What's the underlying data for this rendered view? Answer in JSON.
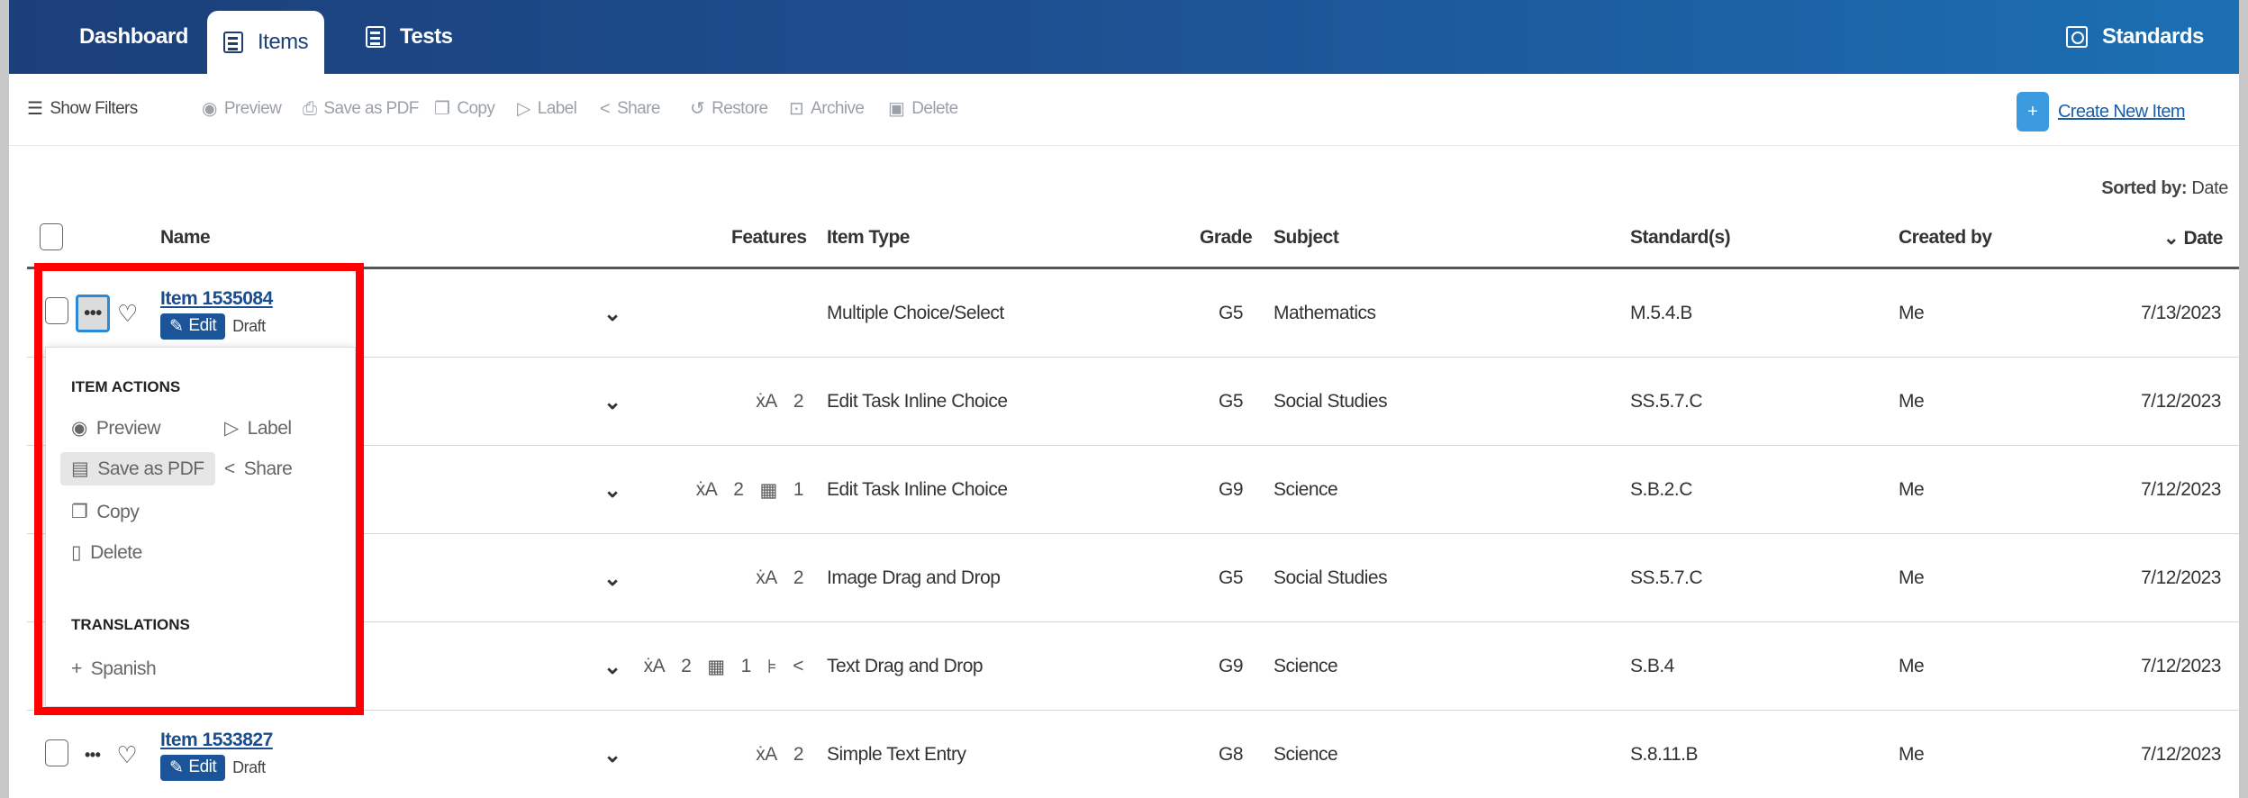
{
  "nav": {
    "dashboard": "Dashboard",
    "items": "Items",
    "tests": "Tests",
    "standards": "Standards"
  },
  "toolbar": {
    "show_filters": "Show Filters",
    "preview": "Preview",
    "save_pdf": "Save as PDF",
    "copy": "Copy",
    "label": "Label",
    "share": "Share",
    "restore": "Restore",
    "archive": "Archive",
    "delete": "Delete",
    "create_new": "Create New Item"
  },
  "sorted": {
    "label": "Sorted by:",
    "value": "Date"
  },
  "columns": {
    "name": "Name",
    "features": "Features",
    "item_type": "Item Type",
    "grade": "Grade",
    "subject": "Subject",
    "standards": "Standard(s)",
    "created_by": "Created by",
    "date": "Date"
  },
  "rows": [
    {
      "name": "Item 1535084",
      "edit": "Edit",
      "status": "Draft",
      "features": "",
      "item_type": "Multiple Choice/Select",
      "grade": "G5",
      "subject": "Mathematics",
      "standard": "M.5.4.B",
      "created_by": "Me",
      "date": "7/13/2023"
    },
    {
      "features": " ̄A2",
      "item_type": "Edit Task Inline Choice",
      "grade": "G5",
      "subject": "Social Studies",
      "standard": "SS.5.7.C",
      "created_by": "Me",
      "date": "7/12/2023"
    },
    {
      "features": "",
      "item_type": "Edit Task Inline Choice",
      "grade": "G9",
      "subject": "Science",
      "standard": "S.B.2.C",
      "created_by": "Me",
      "date": "7/12/2023"
    },
    {
      "features": "",
      "item_type": "Image Drag and Drop",
      "grade": "G5",
      "subject": "Social Studies",
      "standard": "SS.5.7.C",
      "created_by": "Me",
      "date": "7/12/2023"
    },
    {
      "features": "",
      "item_type": "Text Drag and Drop",
      "grade": "G9",
      "subject": "Science",
      "standard": "S.B.4",
      "created_by": "Me",
      "date": "7/12/2023"
    },
    {
      "name": "Item 1533827",
      "edit": "Edit",
      "status": "Draft",
      "features": "",
      "item_type": "Simple Text Entry",
      "grade": "G8",
      "subject": "Science",
      "standard": "S.8.11.B",
      "created_by": "Me",
      "date": "7/12/2023"
    }
  ],
  "feature_counts": {
    "translations": "2",
    "calc": "1"
  },
  "menu": {
    "item_actions": "ITEM ACTIONS",
    "preview": "Preview",
    "label": "Label",
    "save_pdf": "Save as PDF",
    "share": "Share",
    "copy": "Copy",
    "delete": "Delete",
    "translations": "TRANSLATIONS",
    "spanish": "Spanish"
  },
  "colors": {
    "nav_start": "#1b3f7a",
    "nav_end": "#1c6fb3",
    "link": "#1a5ea8",
    "edit_badge": "#1b5498",
    "highlight_outline": "#ff0000"
  }
}
